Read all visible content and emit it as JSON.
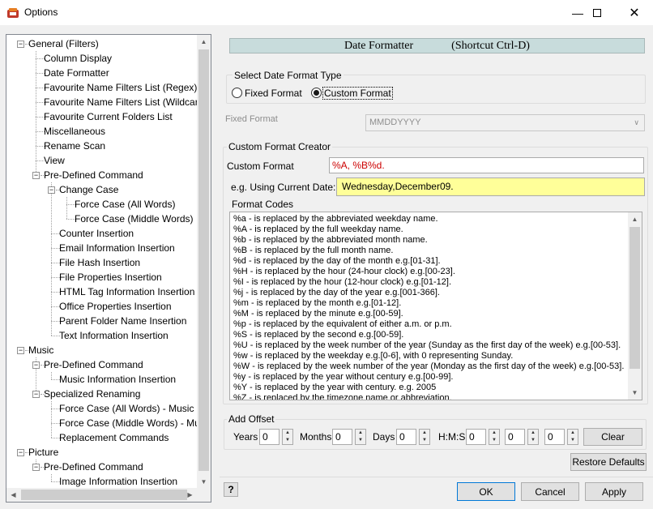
{
  "window": {
    "title": "Options"
  },
  "tree": {
    "items": [
      {
        "label": "General  (Filters)",
        "level": 0,
        "expander": "minus"
      },
      {
        "label": "Column Display",
        "level": 1
      },
      {
        "label": "Date Formatter",
        "level": 1
      },
      {
        "label": "Favourite Name Filters List (Regex)",
        "level": 1
      },
      {
        "label": "Favourite Name Filters List (Wildcard)",
        "level": 1
      },
      {
        "label": "Favourite Current Folders List",
        "level": 1
      },
      {
        "label": "Miscellaneous",
        "level": 1
      },
      {
        "label": "Rename Scan",
        "level": 1
      },
      {
        "label": "View",
        "level": 1
      },
      {
        "label": "Pre-Defined Command",
        "level": 1,
        "expander": "minus"
      },
      {
        "label": "Change Case",
        "level": 2,
        "expander": "minus"
      },
      {
        "label": "Force Case (All Words)",
        "level": 3
      },
      {
        "label": "Force Case (Middle Words)",
        "level": 3
      },
      {
        "label": "Counter Insertion",
        "level": 2
      },
      {
        "label": "Email Information Insertion",
        "level": 2
      },
      {
        "label": "File Hash Insertion",
        "level": 2
      },
      {
        "label": "File Properties Insertion",
        "level": 2
      },
      {
        "label": "HTML Tag Information Insertion",
        "level": 2
      },
      {
        "label": "Office Properties Insertion",
        "level": 2
      },
      {
        "label": "Parent Folder Name Insertion",
        "level": 2
      },
      {
        "label": "Text Information Insertion",
        "level": 2
      },
      {
        "label": "Music",
        "level": 0,
        "expander": "minus"
      },
      {
        "label": "Pre-Defined Command",
        "level": 1,
        "expander": "minus"
      },
      {
        "label": "Music Information Insertion",
        "level": 2
      },
      {
        "label": "Specialized Renaming",
        "level": 1,
        "expander": "minus"
      },
      {
        "label": "Force Case (All Words) - Music",
        "level": 2
      },
      {
        "label": "Force Case (Middle Words) - Music",
        "level": 2
      },
      {
        "label": "Replacement Commands",
        "level": 2
      },
      {
        "label": "Picture",
        "level": 0,
        "expander": "minus"
      },
      {
        "label": "Pre-Defined Command",
        "level": 1,
        "expander": "minus"
      },
      {
        "label": "Image Information Insertion",
        "level": 2
      }
    ]
  },
  "header": {
    "title": "Date Formatter",
    "shortcut": "(Shortcut Ctrl-D)"
  },
  "format_type": {
    "group_label": "Select Date Format Type",
    "fixed_label": "Fixed Format",
    "custom_label": "Custom Format",
    "selected": "custom"
  },
  "fixed_format": {
    "label": "Fixed Format",
    "value": "MMDDYYYY"
  },
  "creator": {
    "group_label": "Custom Format Creator",
    "custom_format_label": "Custom Format",
    "custom_format_value": "%A, %B%d.",
    "example_label": "e.g. Using Current Date:",
    "example_value": "Wednesday,December09.",
    "codes_label": "Format Codes",
    "codes": [
      "%a - is replaced by the abbreviated weekday name.",
      "%A - is replaced by the full weekday name.",
      "%b - is replaced by the abbreviated month name.",
      "%B - is replaced by the full month name.",
      "%d - is replaced by the day of the month e.g.[01-31].",
      "%H - is replaced by the hour (24-hour clock) e.g.[00-23].",
      "%I - is replaced by the hour (12-hour clock) e.g.[01-12].",
      "%j - is replaced by the day of the year e.g.[001-366].",
      "%m - is replaced by the month e.g.[01-12].",
      "%M - is replaced by the minute e.g.[00-59].",
      "%p - is replaced by the equivalent of either a.m. or p.m.",
      "%S - is replaced by the second e.g.[00-59].",
      "%U - is replaced by the week number of the year (Sunday as the first day of the week) e.g.[00-53].",
      "%w - is replaced by the weekday e.g.[0-6], with 0 representing Sunday.",
      "%W - is replaced by the week number of the year (Monday as the first day of the week) e.g.[00-53].",
      "%y - is replaced by the year without century e.g.[00-99].",
      "%Y - is replaced by the year with century. e.g. 2005",
      "%Z - is replaced by the timezone name or abbreviation."
    ]
  },
  "offset": {
    "group_label": "Add Offset",
    "years_label": "Years",
    "years_value": "0",
    "months_label": "Months",
    "months_value": "0",
    "days_label": "Days",
    "days_value": "0",
    "hms_label": "H:M:S",
    "h_value": "0",
    "m_value": "0",
    "s_value": "0",
    "clear_label": "Clear"
  },
  "buttons": {
    "restore_defaults": "Restore Defaults",
    "help": "?",
    "ok": "OK",
    "cancel": "Cancel",
    "apply": "Apply"
  },
  "colors": {
    "header_bg": "#c8dcdc",
    "example_bg": "#ffff99",
    "custom_format_text": "#cc0000"
  }
}
